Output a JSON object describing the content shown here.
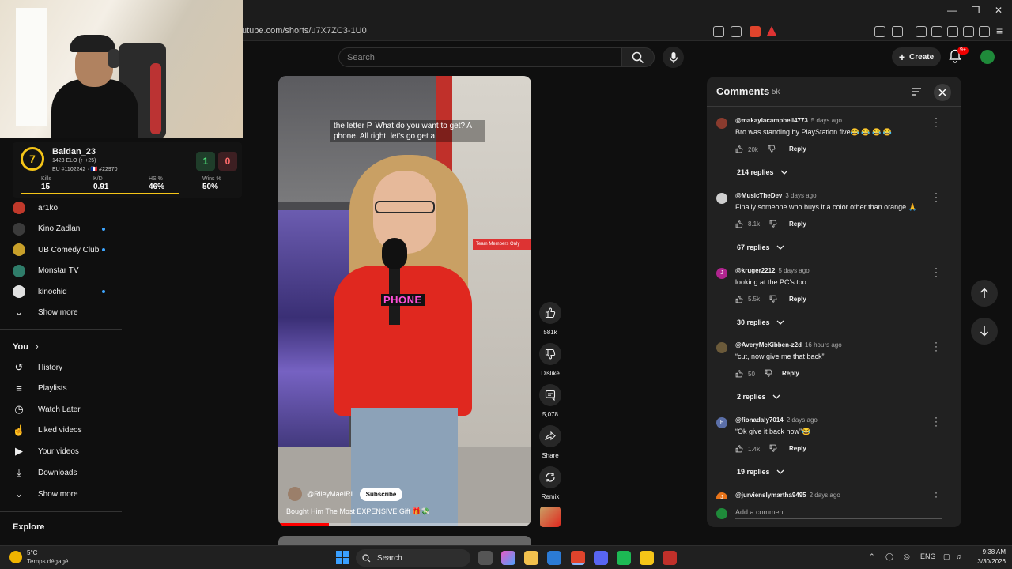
{
  "browser": {
    "url": "utube.com/shorts/u7X7ZC3-1U0"
  },
  "overlay": {
    "level": "7",
    "player_name": "Baldan_23",
    "elo": "1423 ELO (↑ +25)",
    "region": "EU #1102242 · 🇫🇷 #22970",
    "stats": [
      {
        "label": "Kills",
        "value": "15"
      },
      {
        "label": "K/D",
        "value": "0.91"
      },
      {
        "label": "HS %",
        "value": "46%"
      },
      {
        "label": "Wins %",
        "value": "50%"
      }
    ],
    "score_win": "1",
    "score_loss": "0"
  },
  "topbar": {
    "search_placeholder": "Search",
    "create_label": "Create",
    "notif_badge": "9+"
  },
  "sidebar": {
    "subscriptions": [
      {
        "label": "ar1ko",
        "color": "#c0392b",
        "dot": false
      },
      {
        "label": "Kino Zadlan",
        "color": "#3b3b3b",
        "dot": true
      },
      {
        "label": "UB Comedy Club",
        "color": "#c8a02a",
        "dot": true
      },
      {
        "label": "Monstar TV",
        "color": "#2f7d6a",
        "dot": false
      },
      {
        "label": "kinochid",
        "color": "#e0e0e0",
        "dot": true
      }
    ],
    "show_more_1": "Show more",
    "you_heading": "You",
    "you_items": [
      {
        "label": "History",
        "icon": "history-icon"
      },
      {
        "label": "Playlists",
        "icon": "playlists-icon"
      },
      {
        "label": "Watch Later",
        "icon": "watch-later-icon"
      },
      {
        "label": "Liked videos",
        "icon": "thumbs-up-icon"
      },
      {
        "label": "Your videos",
        "icon": "your-videos-icon"
      },
      {
        "label": "Downloads",
        "icon": "download-icon"
      }
    ],
    "show_more_2": "Show more",
    "explore_heading": "Explore"
  },
  "video": {
    "caption": "the letter P. What do you want to get? A phone. All right, let's go get a",
    "overlay_word": "PHONE",
    "store_sign": "Team Members Only",
    "channel": "@RileyMaeIRL",
    "subscribe_label": "Subscribe",
    "title": "Bought Him The Most EXPENSIVE Gift 🎁💸",
    "progress": 0.2
  },
  "actions": {
    "likes": "581k",
    "dislike": "Dislike",
    "comments": "5,078",
    "share": "Share",
    "remix": "Remix"
  },
  "comments_panel": {
    "title": "Comments",
    "count": "5k",
    "add_placeholder": "Add a comment...",
    "items": [
      {
        "author": "@makaylacampbell4773",
        "time": "5 days ago",
        "text": "Bro was standing by PlayStation five😂 😂 😂 😂",
        "likes": "20k",
        "reply": "Reply",
        "replies": "214 replies",
        "avatar_color": "#8a3b2e",
        "avatar_letter": ""
      },
      {
        "author": "@MusicTheDev",
        "time": "3 days ago",
        "text": "Finally someone who buys it a color other than orange 🙏",
        "likes": "8.1k",
        "reply": "Reply",
        "replies": "67 replies",
        "avatar_color": "#cfcfcf",
        "avatar_letter": ""
      },
      {
        "author": "@kruger2212",
        "time": "5 days ago",
        "text": "looking at the PC's too",
        "likes": "5.5k",
        "reply": "Reply",
        "replies": "30 replies",
        "avatar_color": "#b0258f",
        "avatar_letter": "J"
      },
      {
        "author": "@AveryMcKibben-z2d",
        "time": "16 hours ago",
        "text": "“cut, now give me that back”",
        "likes": "50",
        "reply": "Reply",
        "replies": "2 replies",
        "avatar_color": "#6b5a3a",
        "avatar_letter": ""
      },
      {
        "author": "@fionadaly7014",
        "time": "2 days ago",
        "text": "“Ok give it back now”😂",
        "likes": "1.4k",
        "reply": "Reply",
        "replies": "19 replies",
        "avatar_color": "#5b6fa8",
        "avatar_letter": "F"
      },
      {
        "author": "@jurvienslymartha9495",
        "time": "2 days ago",
        "text": "",
        "likes": "",
        "reply": "",
        "replies": "",
        "avatar_color": "#e8741a",
        "avatar_letter": "J"
      }
    ]
  },
  "taskbar": {
    "weather_temp": "5°C",
    "weather_desc": "Temps dégagé",
    "search_label": "Search",
    "lang": "ENG",
    "time": "9:38 AM",
    "date": "3/30/2026"
  },
  "colors": {
    "accent_red": "#ff0000",
    "link_blue": "#3ea6ff",
    "panel_bg": "#212121"
  }
}
